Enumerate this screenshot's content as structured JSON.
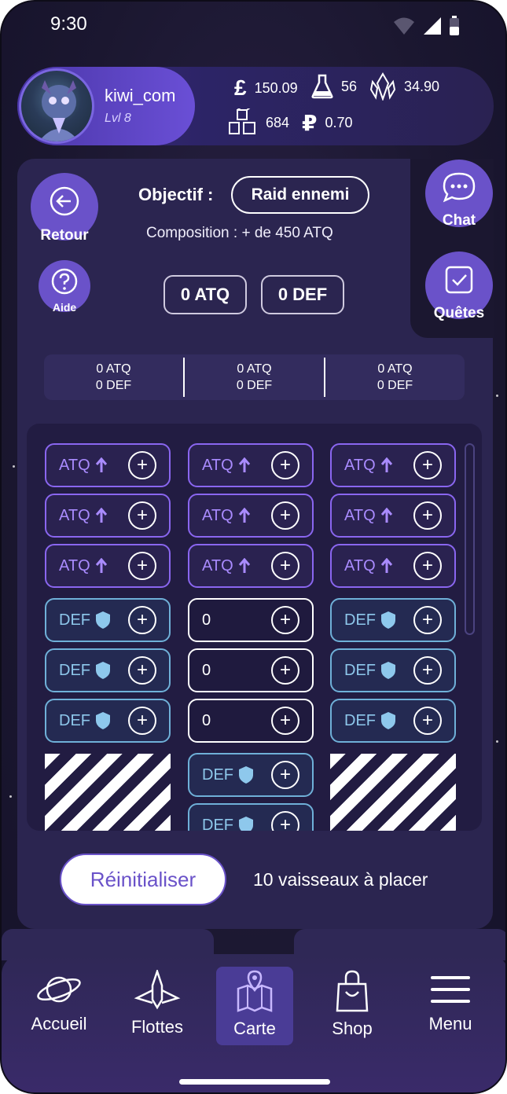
{
  "status": {
    "time": "9:30"
  },
  "profile": {
    "username": "kiwi_com",
    "level": "Lvl 8"
  },
  "resources": {
    "pound": "150.09",
    "flask": "56",
    "crystal": "34.90",
    "cubes": "684",
    "ruble": "0.70"
  },
  "side": {
    "back": "Retour",
    "help": "Aide",
    "chat": "Chat",
    "quests": "Quêtes"
  },
  "objective": {
    "label": "Objectif :",
    "value": "Raid ennemi",
    "composition": "Composition : + de 450 ATQ",
    "atq_total": "0 ATQ",
    "def_total": "0 DEF"
  },
  "summary": [
    {
      "atq": "0 ATQ",
      "def": "0 DEF"
    },
    {
      "atq": "0 ATQ",
      "def": "0 DEF"
    },
    {
      "atq": "0 ATQ",
      "def": "0 DEF"
    }
  ],
  "slots": {
    "atq": "ATQ",
    "def": "DEF",
    "empty": "0"
  },
  "footer": {
    "reset": "Réinitialiser",
    "ships_left": "10 vaisseaux à placer"
  },
  "nav": {
    "home": "Accueil",
    "fleets": "Flottes",
    "map": "Carte",
    "shop": "Shop",
    "menu": "Menu"
  },
  "colors": {
    "accent": "#6a52c9",
    "atq": "#8a66f0",
    "def": "#6fb0d8"
  }
}
